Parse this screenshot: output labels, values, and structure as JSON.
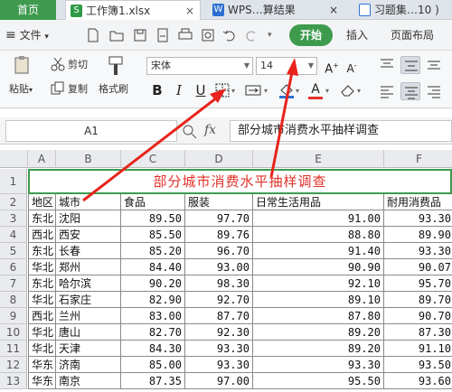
{
  "tabs": {
    "home": "首页",
    "file1": "工作簿1.xlsx",
    "file2": "WPS…算结果",
    "file3": "习题集…10 )",
    "close": "×"
  },
  "menu": {
    "file_menu": "文件",
    "start": "开始",
    "insert": "插入",
    "page_layout": "页面布局"
  },
  "toolbar": {
    "paste": "粘贴",
    "cut": "剪切",
    "copy": "复制",
    "format_painter": "格式刷",
    "font_name": "宋体",
    "font_size": "14",
    "bold": "B",
    "italic": "I",
    "underline": "U"
  },
  "formula_bar": {
    "cell_ref": "A1",
    "fx": "fx",
    "content": "部分城市消费水平抽样调查"
  },
  "sheet": {
    "title": "部分城市消费水平抽样调查",
    "columns": [
      "A",
      "B",
      "C",
      "D",
      "E",
      "F"
    ],
    "header_row": [
      "地区",
      "城市",
      "食品",
      "服装",
      "日常生活用品",
      "耐用消费品"
    ],
    "rows": [
      [
        "东北",
        "沈阳",
        "89.50",
        "97.70",
        "91.00",
        "93.30"
      ],
      [
        "西北",
        "西安",
        "85.50",
        "89.76",
        "88.80",
        "89.90"
      ],
      [
        "东北",
        "长春",
        "85.20",
        "96.70",
        "91.40",
        "93.30"
      ],
      [
        "华北",
        "郑州",
        "84.40",
        "93.00",
        "90.90",
        "90.07"
      ],
      [
        "东北",
        "哈尔滨",
        "90.20",
        "98.30",
        "92.10",
        "95.70"
      ],
      [
        "华北",
        "石家庄",
        "82.90",
        "92.70",
        "89.10",
        "89.70"
      ],
      [
        "西北",
        "兰州",
        "83.00",
        "87.70",
        "87.80",
        "90.70"
      ],
      [
        "华北",
        "唐山",
        "82.70",
        "92.30",
        "89.20",
        "87.30"
      ],
      [
        "华北",
        "天津",
        "84.30",
        "93.30",
        "89.20",
        "91.10"
      ],
      [
        "华东",
        "济南",
        "85.00",
        "93.30",
        "93.30",
        "93.50"
      ],
      [
        "华东",
        "南京",
        "87.35",
        "97.00",
        "95.50",
        "93.60"
      ]
    ]
  },
  "colors": {
    "accent": "#3e9b4e",
    "title_text": "#e0312a",
    "arrow": "#e8231b"
  }
}
